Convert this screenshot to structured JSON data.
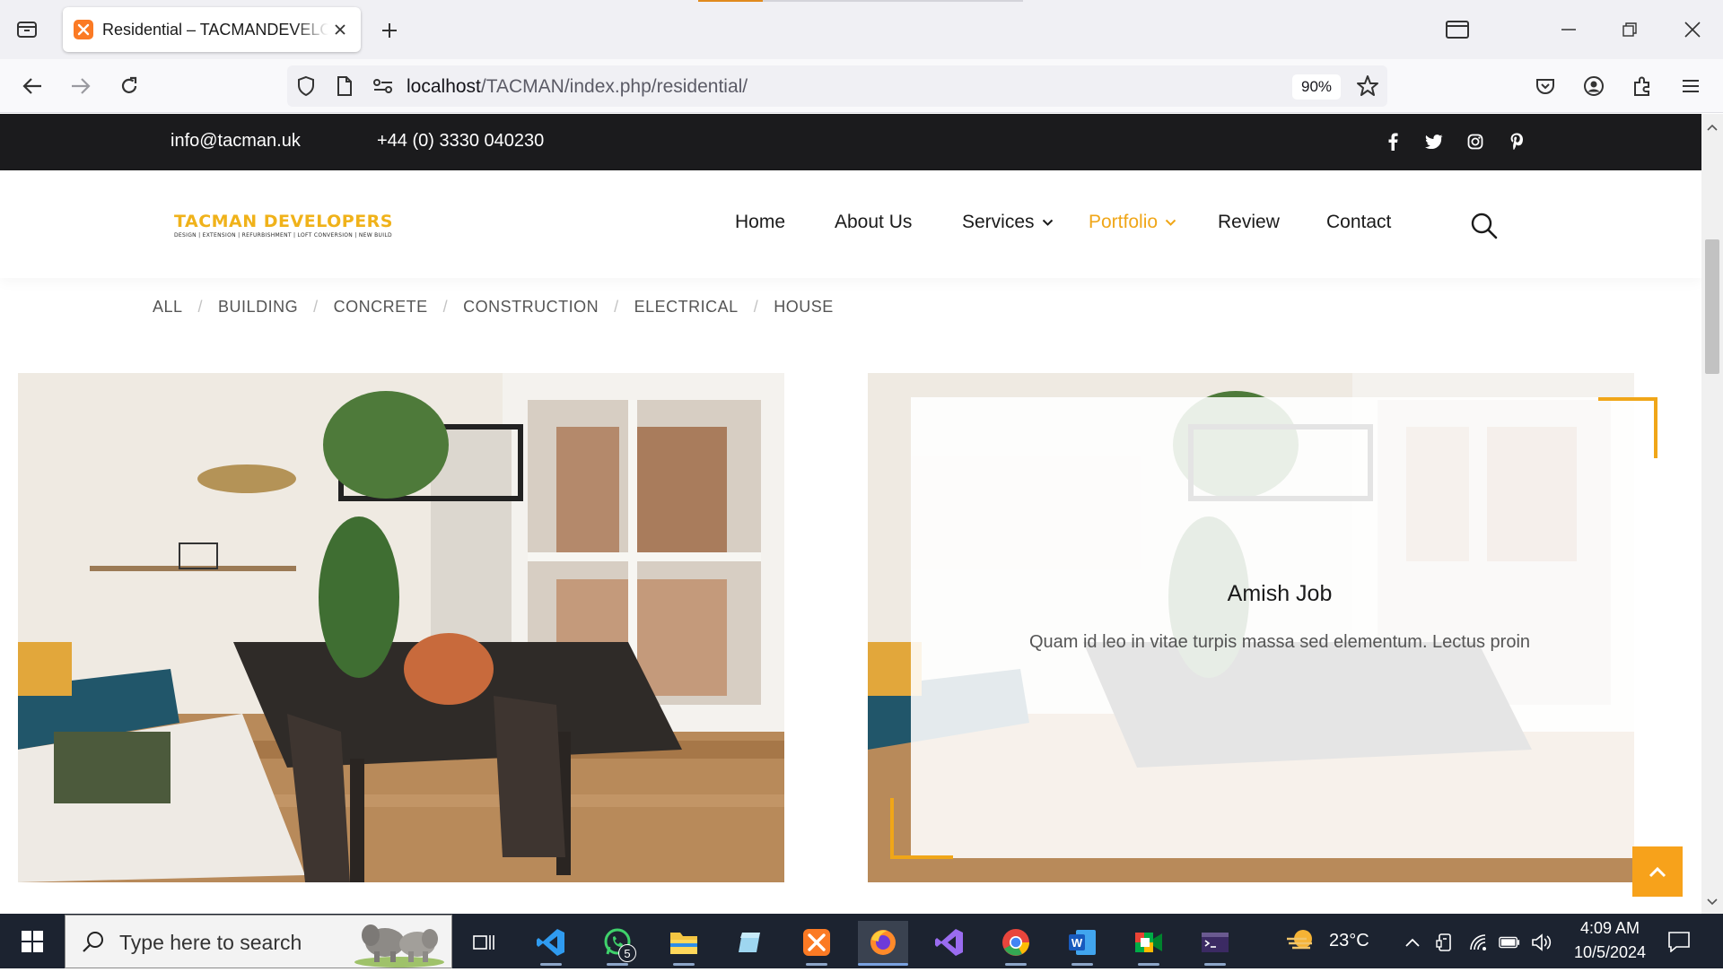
{
  "browser": {
    "tab_title": "Residential – TACMANDEVELOPERS",
    "url_host": "localhost",
    "url_path": "/TACMAN/index.php/residential/",
    "zoom": "90%"
  },
  "topbar": {
    "email": "info@tacman.uk",
    "phone": "+44 (0)  3330 040230",
    "social_icons": [
      "facebook-icon",
      "twitter-icon",
      "instagram-icon",
      "pinterest-icon"
    ]
  },
  "header": {
    "logo_text": "TACMAN DEVELOPERS",
    "logo_tagline": "DESIGN | EXTENSION | REFURBISHMENT | LOFT CONVERSION | NEW BUILD",
    "menu": [
      {
        "label": "Home"
      },
      {
        "label": "About Us"
      },
      {
        "label": "Services"
      },
      {
        "label": "Portfolio"
      },
      {
        "label": "Review"
      },
      {
        "label": "Contact"
      }
    ],
    "active_menu": "Portfolio"
  },
  "filters": [
    "ALL",
    "BUILDING",
    "CONCRETE",
    "CONSTRUCTION",
    "ELECTRICAL",
    "HOUSE"
  ],
  "portfolio": {
    "hover_card": {
      "title": "Amish Job",
      "description": "Quam id leo in vitae turpis massa sed elementum. Lectus proin"
    }
  },
  "colors": {
    "accent": "#f0a618",
    "topbar_bg": "#1b1b1d",
    "taskbar_bg": "#1c2330",
    "back_to_top": "#f7a21b"
  },
  "taskbar": {
    "search_placeholder": "Type here to search",
    "whatsapp_badge": "5",
    "weather": "23°C",
    "time": "4:09 AM",
    "date": "10/5/2024"
  }
}
